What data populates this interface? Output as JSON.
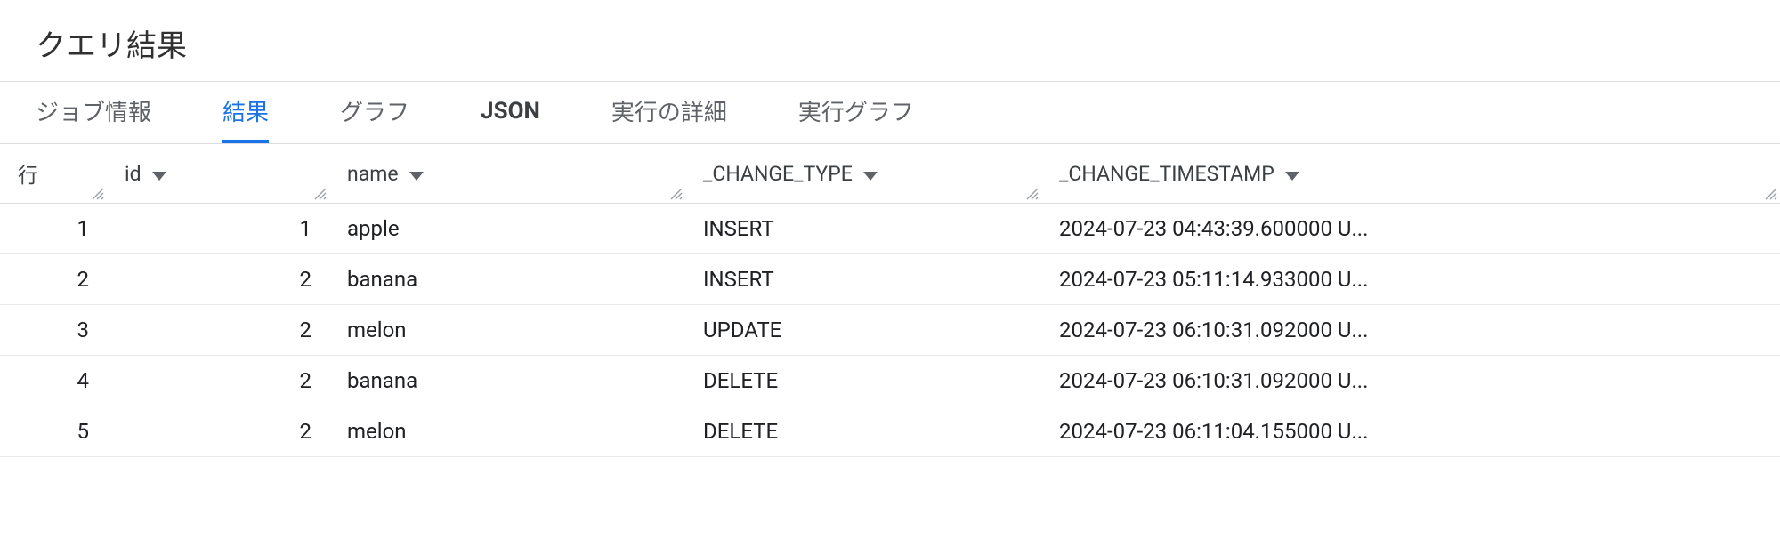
{
  "header": {
    "title": "クエリ結果"
  },
  "tabs": {
    "items": [
      {
        "label": "ジョブ情報",
        "active": false,
        "key": "job-info"
      },
      {
        "label": "結果",
        "active": true,
        "key": "results"
      },
      {
        "label": "グラフ",
        "active": false,
        "key": "chart"
      },
      {
        "label": "JSON",
        "active": false,
        "key": "json"
      },
      {
        "label": "実行の詳細",
        "active": false,
        "key": "exec-details"
      },
      {
        "label": "実行グラフ",
        "active": false,
        "key": "exec-graph"
      }
    ]
  },
  "table": {
    "columns": [
      {
        "label": "行",
        "sortable": false,
        "key": "row"
      },
      {
        "label": "id",
        "sortable": true,
        "key": "id"
      },
      {
        "label": "name",
        "sortable": true,
        "key": "name"
      },
      {
        "label": "_CHANGE_TYPE",
        "sortable": true,
        "key": "_CHANGE_TYPE"
      },
      {
        "label": "_CHANGE_TIMESTAMP",
        "sortable": true,
        "key": "_CHANGE_TIMESTAMP"
      }
    ],
    "rows": [
      {
        "row": "1",
        "id": "1",
        "name": "apple",
        "_CHANGE_TYPE": "INSERT",
        "_CHANGE_TIMESTAMP": "2024-07-23 04:43:39.600000 U..."
      },
      {
        "row": "2",
        "id": "2",
        "name": "banana",
        "_CHANGE_TYPE": "INSERT",
        "_CHANGE_TIMESTAMP": "2024-07-23 05:11:14.933000 U..."
      },
      {
        "row": "3",
        "id": "2",
        "name": "melon",
        "_CHANGE_TYPE": "UPDATE",
        "_CHANGE_TIMESTAMP": "2024-07-23 06:10:31.092000 U..."
      },
      {
        "row": "4",
        "id": "2",
        "name": "banana",
        "_CHANGE_TYPE": "DELETE",
        "_CHANGE_TIMESTAMP": "2024-07-23 06:10:31.092000 U..."
      },
      {
        "row": "5",
        "id": "2",
        "name": "melon",
        "_CHANGE_TYPE": "DELETE",
        "_CHANGE_TIMESTAMP": "2024-07-23 06:11:04.155000 U..."
      }
    ]
  },
  "icons": {
    "sort": "caret-down-icon",
    "resize": "resize-handle-icon"
  }
}
